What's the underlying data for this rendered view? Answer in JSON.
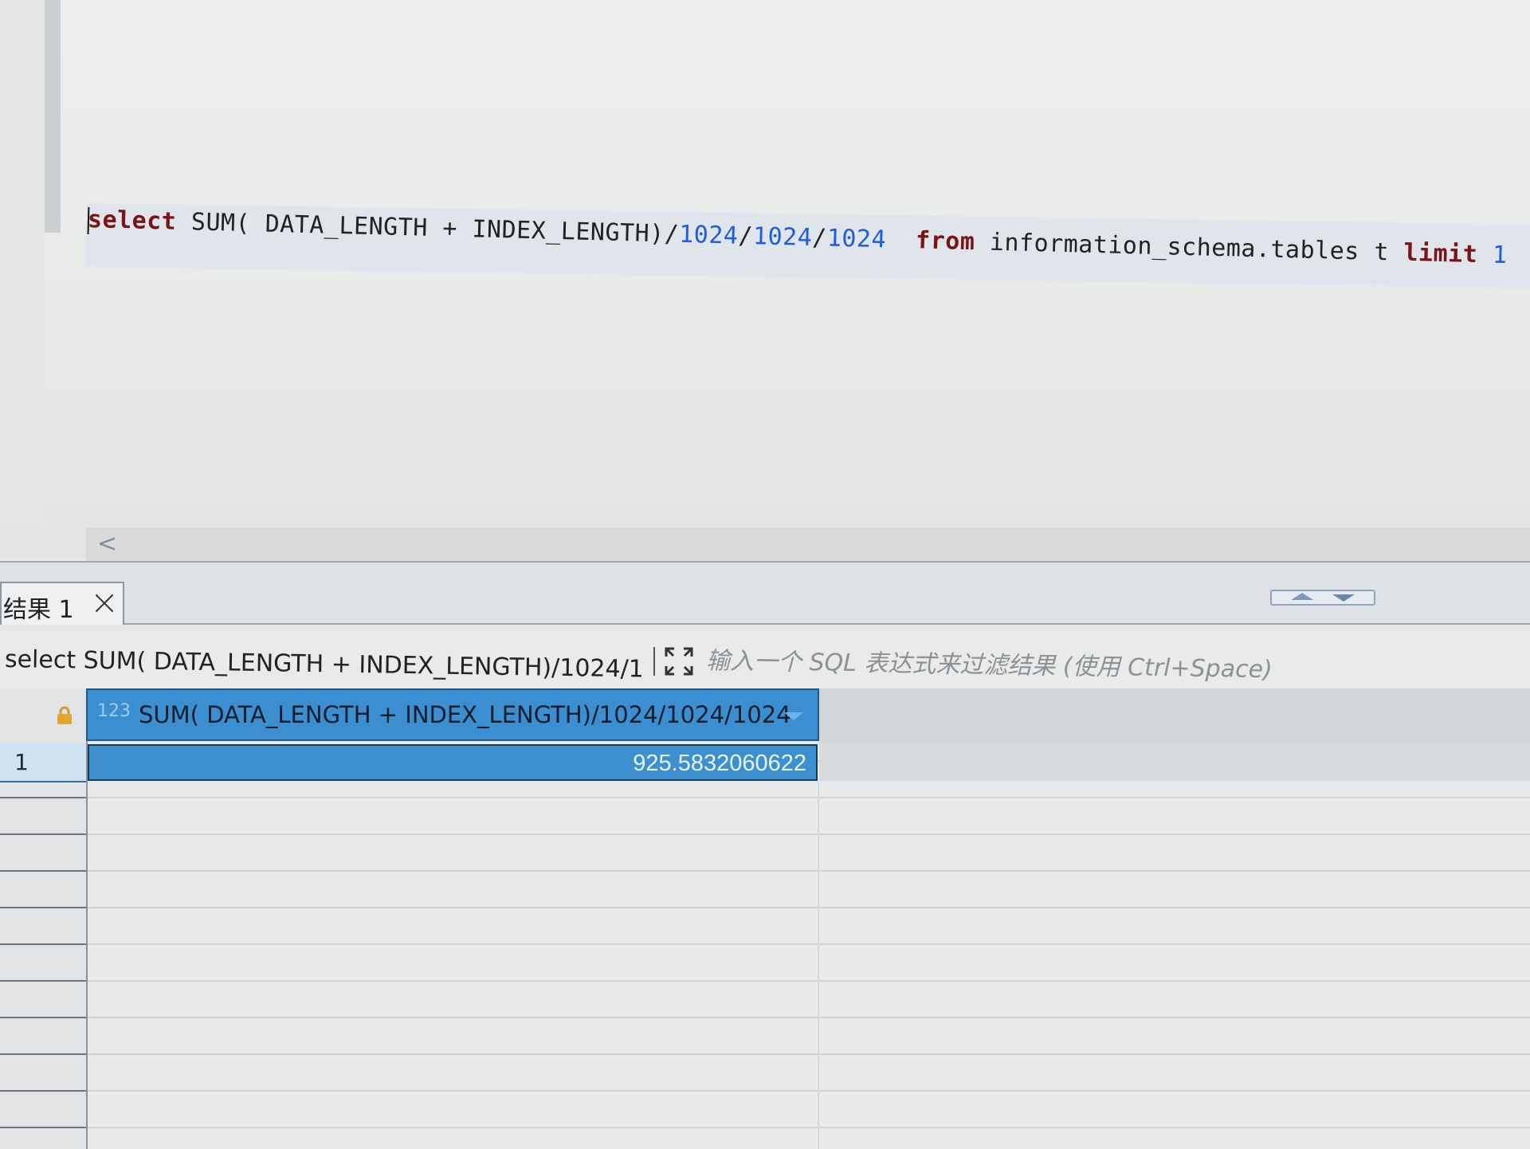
{
  "editor": {
    "sql": {
      "t1": "select",
      "t2": " SUM( DATA_LENGTH + INDEX_LENGTH)/",
      "t3": "1024",
      "t4": "/",
      "t5": "1024",
      "t6": "/",
      "t7": "1024",
      "t8": "  ",
      "t9": "from",
      "t10": " information_schema.tables t ",
      "t11": "limit",
      "t12": " ",
      "t13": "1"
    },
    "scroll_left_glyph": "<"
  },
  "results": {
    "tab_label": "结果 1",
    "filter_query": "select SUM( DATA_LENGTH + INDEX_LENGTH)/1024/1",
    "filter_placeholder": "输入一个 SQL 表达式来过滤结果 (使用 Ctrl+Space)",
    "column": {
      "type_badge": "123",
      "title": "SUM( DATA_LENGTH + INDEX_LENGTH)/1024/1024/1024"
    },
    "rows": [
      {
        "num": "1",
        "value": "925.5832060622"
      }
    ]
  },
  "colors": {
    "keyword": "#7a1515",
    "number": "#1e5ed8",
    "selection": "#3d90d0"
  }
}
